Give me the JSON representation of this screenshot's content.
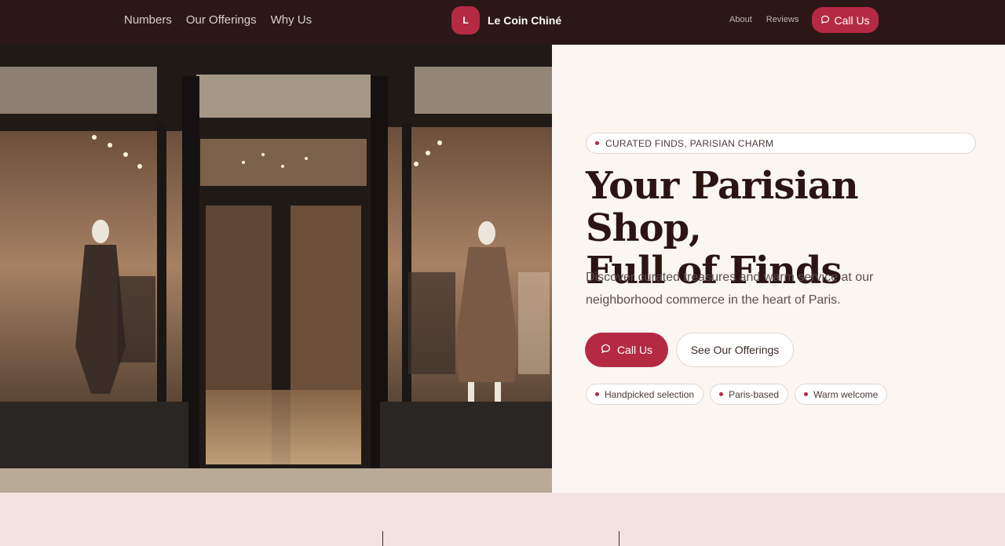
{
  "nav": {
    "left_links": [
      "Numbers",
      "Our Offerings",
      "Why Us"
    ],
    "brand_initial": "L",
    "brand_name": "Le Coin Chiné",
    "right_links": [
      "About",
      "Reviews"
    ],
    "call_label": "Call Us"
  },
  "hero": {
    "eyebrow": "CURATED FINDS, PARISIAN CHARM",
    "title_line1": "Your Parisian Shop,",
    "title_line2": "Full of Finds",
    "subtitle": "Discover curated treasures and warm service at our neighborhood commerce in the heart of Paris.",
    "primary_cta": "Call Us",
    "secondary_cta": "See Our Offerings",
    "chips": [
      "Handpicked selection",
      "Paris-based",
      "Warm welcome"
    ]
  },
  "colors": {
    "accent": "#b52a43",
    "topbar": "#2b1816",
    "panel": "#fbf6f2",
    "stats_band": "#f3e3e0"
  },
  "icons": {
    "chat": "chat-bubble-icon"
  }
}
